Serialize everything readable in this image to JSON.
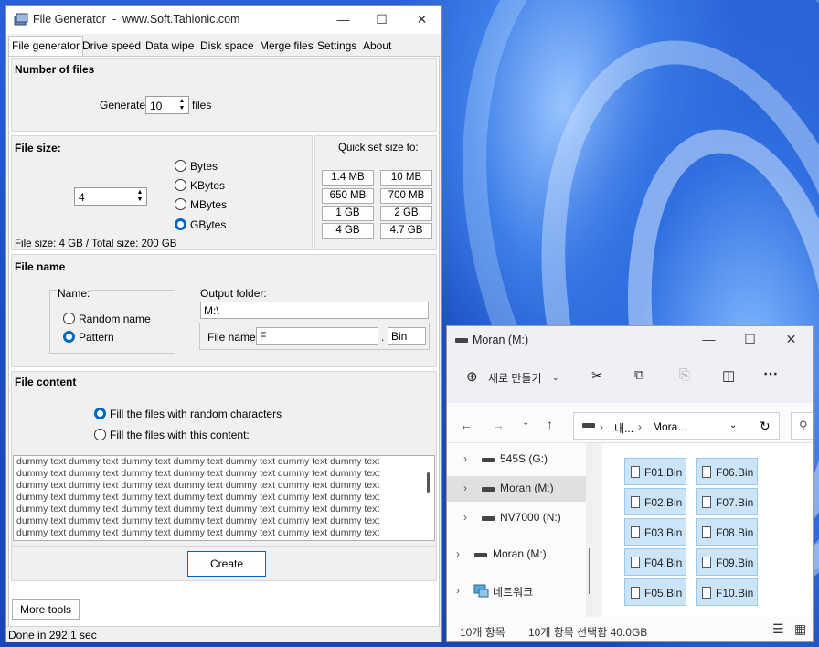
{
  "file_generator": {
    "title": "File Generator  -  www.Soft.Tahionic.com",
    "tabs": [
      "File generator",
      "Drive speed",
      "Data wipe",
      "Disk space",
      "Merge files",
      "Settings",
      "About"
    ],
    "number_of_files": {
      "heading": "Number of files",
      "generate_label": "Generate",
      "count": "10",
      "files_label": "files"
    },
    "file_size": {
      "heading": "File size:",
      "value": "4",
      "units": [
        "Bytes",
        "KBytes",
        "MBytes",
        "GBytes"
      ],
      "selected_unit": "GBytes",
      "quick_set_label": "Quick set size to:",
      "quick_sizes": [
        "1.4 MB",
        "10 MB",
        "650 MB",
        "700 MB",
        "1 GB",
        "2 GB",
        "4 GB",
        "4.7 GB"
      ],
      "summary": "File size: 4 GB / Total size: 200 GB"
    },
    "file_name": {
      "heading": "File name",
      "name_group_label": "Name:",
      "options": [
        "Random name",
        "Pattern"
      ],
      "selected_option": "Pattern",
      "output_folder_label": "Output folder:",
      "output_folder": "M:\\",
      "file_name_label": "File name:",
      "file_name": "F",
      "dot": ".",
      "extension": "Bin"
    },
    "file_content": {
      "heading": "File content",
      "options": [
        "Fill the files with random characters",
        "Fill the files with this content:"
      ],
      "selected_option": "Fill the files with random characters",
      "lines": [
        "dummy text dummy text dummy text dummy text dummy text dummy text dummy text",
        "dummy text dummy text dummy text dummy text dummy text dummy text dummy text",
        "dummy text dummy text dummy text dummy text dummy text dummy text dummy text",
        "dummy text dummy text dummy text dummy text dummy text dummy text dummy text",
        "dummy text dummy text dummy text dummy text dummy text dummy text dummy text",
        "dummy text dummy text dummy text dummy text dummy text dummy text dummy text",
        "dummy text dummy text dummy text dummy text dummy text dummy text dummy text"
      ]
    },
    "create_label": "Create",
    "more_tools_label": "More tools",
    "status": "Done in 292.1 sec"
  },
  "explorer": {
    "title": "Moran (M:)",
    "new_label": "새로 만들기",
    "breadcrumb": [
      "내...",
      "Mora..."
    ],
    "nav_items": [
      {
        "label": "545S (G:)",
        "icon": "drive-icon",
        "selected": false
      },
      {
        "label": "Moran (M:)",
        "icon": "drive-icon",
        "selected": true
      },
      {
        "label": "NV7000 (N:)",
        "icon": "drive-icon",
        "selected": false
      },
      {
        "label": "Moran (M:)",
        "icon": "drive-icon",
        "selected": false
      },
      {
        "label": "네트워크",
        "icon": "network-icon",
        "selected": false
      }
    ],
    "files": [
      "F01.Bin",
      "F02.Bin",
      "F03.Bin",
      "F04.Bin",
      "F05.Bin",
      "F06.Bin",
      "F07.Bin",
      "F08.Bin",
      "F09.Bin",
      "F10.Bin"
    ],
    "status_count": "10개 항목",
    "status_selected": "10개 항목 선택함 40.0GB"
  },
  "colors": {
    "accent": "#0067c0",
    "selection": "#cce4f7"
  }
}
